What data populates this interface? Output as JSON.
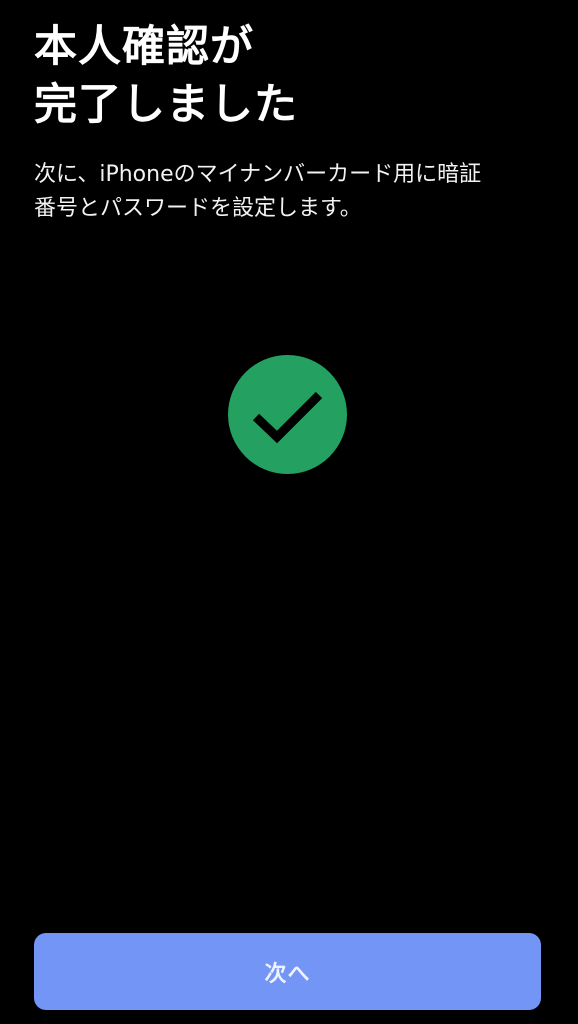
{
  "header": {
    "title": "本人確認が\n完了しました"
  },
  "body": {
    "description": "次に、iPhoneのマイナンバーカード用に暗証\n番号とパスワードを設定します。"
  },
  "status": {
    "icon": "checkmark-circle-icon",
    "color": "#24a061"
  },
  "footer": {
    "next_label": "次へ",
    "button_color": "#7295f6"
  }
}
